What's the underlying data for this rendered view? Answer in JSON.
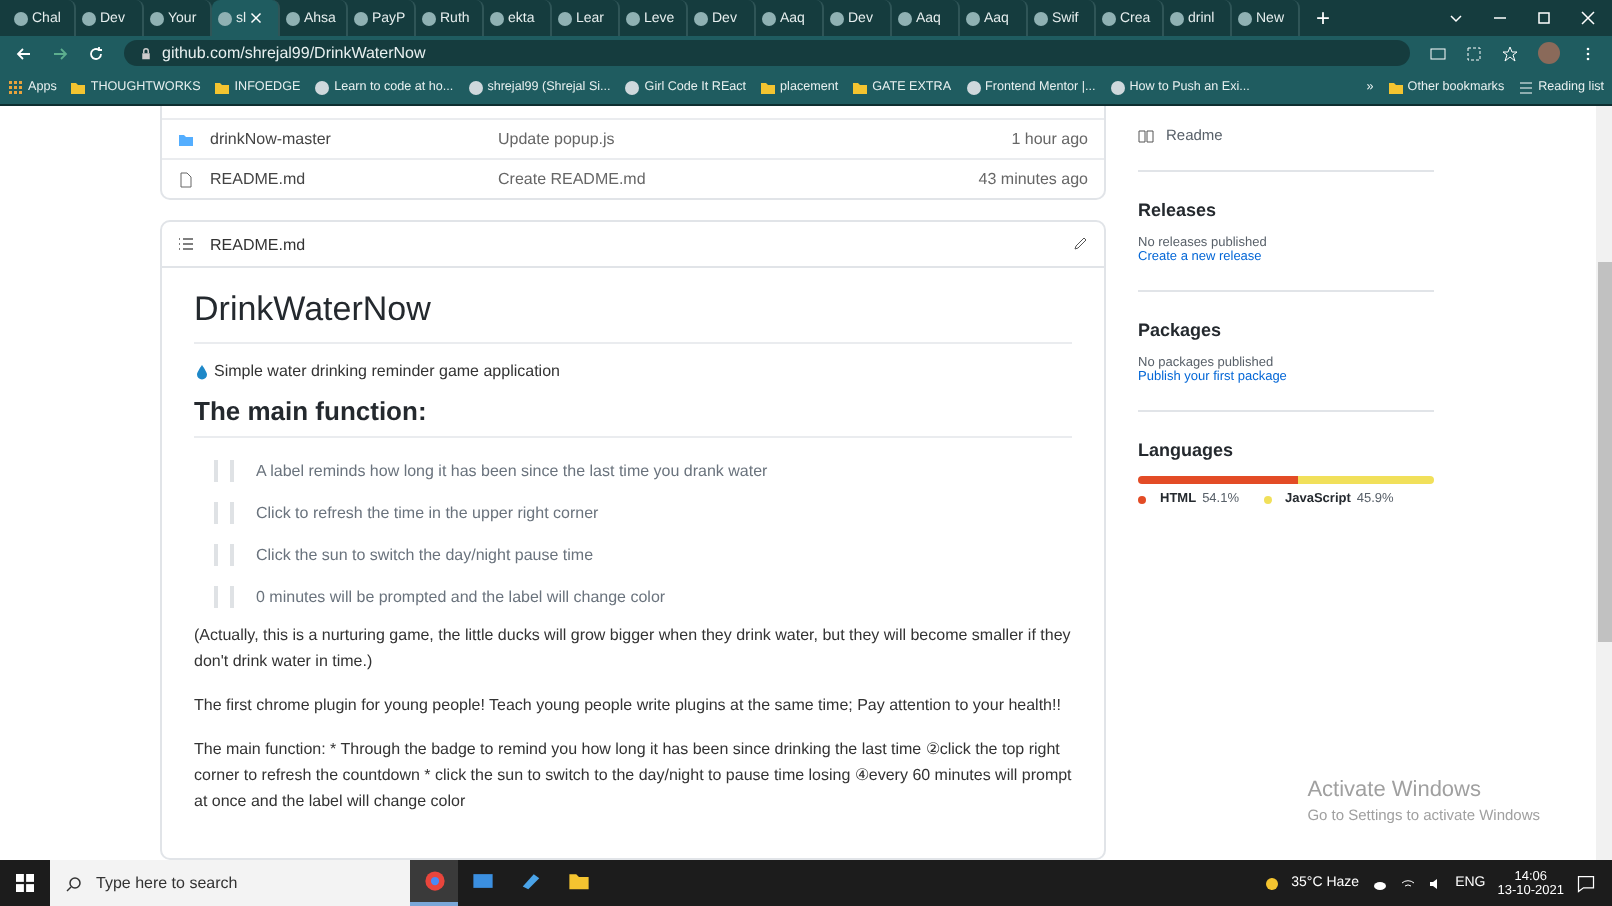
{
  "browser": {
    "tabs": [
      {
        "label": "Chal",
        "selected": false
      },
      {
        "label": "Dev",
        "selected": false
      },
      {
        "label": "Your",
        "selected": false
      },
      {
        "label": "sl",
        "selected": true
      },
      {
        "label": "Ahsa",
        "selected": false
      },
      {
        "label": "PayP",
        "selected": false
      },
      {
        "label": "Ruth",
        "selected": false
      },
      {
        "label": "ekta",
        "selected": false
      },
      {
        "label": "Lear",
        "selected": false
      },
      {
        "label": "Leve",
        "selected": false
      },
      {
        "label": "Dev",
        "selected": false
      },
      {
        "label": "Aaq",
        "selected": false
      },
      {
        "label": "Dev",
        "selected": false
      },
      {
        "label": "Aaq",
        "selected": false
      },
      {
        "label": "Aaq",
        "selected": false
      },
      {
        "label": "Swif",
        "selected": false
      },
      {
        "label": "Crea",
        "selected": false
      },
      {
        "label": "drinl",
        "selected": false
      },
      {
        "label": "New",
        "selected": false
      }
    ],
    "new_tab": "+",
    "url": "github.com/shrejal99/DrinkWaterNow",
    "bookmarks": [
      {
        "label": "Apps",
        "kind": "apps"
      },
      {
        "label": "THOUGHTWORKS",
        "kind": "folder"
      },
      {
        "label": "INFOEDGE",
        "kind": "folder"
      },
      {
        "label": "Learn to code at ho...",
        "kind": "site"
      },
      {
        "label": "shrejal99 (Shrejal Si...",
        "kind": "site"
      },
      {
        "label": "Girl Code It REact",
        "kind": "site"
      },
      {
        "label": "placement",
        "kind": "folder"
      },
      {
        "label": "GATE EXTRA",
        "kind": "folder"
      },
      {
        "label": "Frontend Mentor |...",
        "kind": "site"
      },
      {
        "label": "How to Push an Exi...",
        "kind": "site"
      }
    ],
    "more_bookmarks": "»",
    "other_bookmarks": "Other bookmarks",
    "reading_list": "Reading list"
  },
  "files": [
    {
      "name": "drinkNow-master",
      "kind": "folder",
      "commit": "Update popup.js",
      "time": "1 hour ago"
    },
    {
      "name": "README.md",
      "kind": "file",
      "commit": "Create README.md",
      "time": "43 minutes ago"
    }
  ],
  "readme": {
    "header": "README.md",
    "title": "DrinkWaterNow",
    "tagline": "Simple water drinking reminder game application",
    "heading": "The main function:",
    "quotes": [
      "A label reminds how long it has been since the last time you drank water",
      "Click to refresh the time in the upper right corner",
      "Click the sun to switch the day/night pause time",
      "0 minutes will be prompted and the label will change color"
    ],
    "paragraphs": [
      "(Actually, this is a nurturing game, the little ducks will grow bigger when they drink water, but they will become smaller if they don't drink water in time.)",
      "The first chrome plugin for young people! Teach young people write plugins at the same time; Pay attention to your health!!",
      "The main function: * Through the badge to remind you how long it has been since drinking the last time ②click the top right corner to refresh the countdown * click the sun to switch to the day/night to pause time losing ④every 60 minutes will prompt at once and the label will change color"
    ]
  },
  "sidebar": {
    "readme_link": "Readme",
    "sections": [
      {
        "title": "Releases",
        "note": "No releases published",
        "link": "Create a new release"
      },
      {
        "title": "Packages",
        "note": "No packages published",
        "link": "Publish your first package"
      }
    ],
    "languages": {
      "title": "Languages",
      "items": [
        {
          "name": "HTML",
          "percent": "54.1%",
          "level": 0.541,
          "color": "#e34c26"
        },
        {
          "name": "JavaScript",
          "percent": "45.9%",
          "level": 0.459,
          "color": "#f1e05a"
        }
      ]
    }
  },
  "activation": {
    "title": "Activate Windows",
    "subtitle": "Go to Settings to activate Windows"
  },
  "taskbar": {
    "search_placeholder": "Type here to search",
    "weather": "35°C Haze",
    "language": "ENG",
    "time": "14:06",
    "date": "13-10-2021"
  }
}
